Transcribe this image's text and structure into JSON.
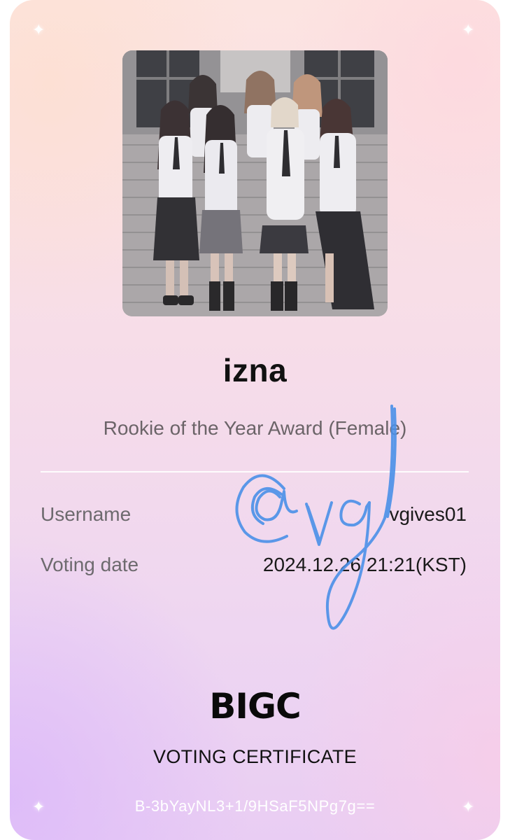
{
  "certificate": {
    "artist": "izna",
    "award": "Rookie of the Year Award (Female)",
    "rows": [
      {
        "label": "Username",
        "value": "vgives01"
      },
      {
        "label": "Voting date",
        "value": "2024.12.26 21:21(KST)"
      }
    ],
    "brand": "BIGC",
    "subtitle": "VOTING CERTIFICATE",
    "code": "B-3bYayNL3+1/9HSaF5NPg7g=="
  },
  "signature": {
    "text": "@vg",
    "color": "#4a90e8"
  },
  "icons": {
    "sparkle": "sparkle-icon",
    "sparkle_glyph": "✦"
  },
  "colors": {
    "card_top": "#fce4e1",
    "card_bottom": "#e9cdf3",
    "text_dark": "#111111",
    "text_muted": "#6d6a6e",
    "code_text": "#ffffff"
  }
}
